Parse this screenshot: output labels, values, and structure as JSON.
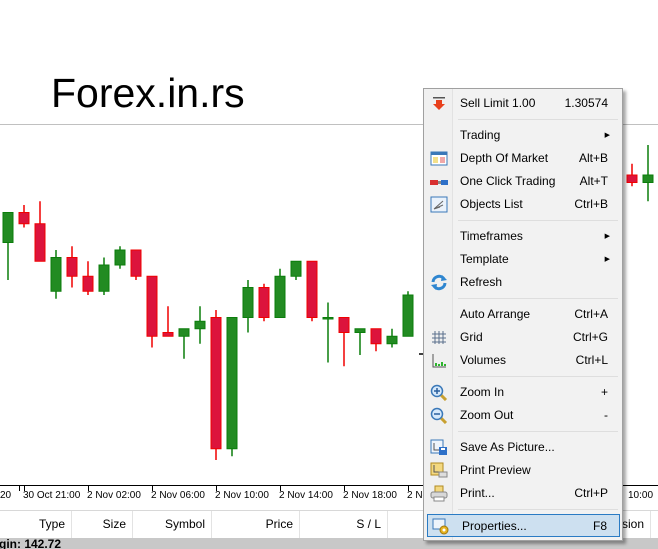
{
  "watermark": "Forex.in.rs",
  "colors": {
    "bull": "#228B22",
    "bull_border": "#0b7d0b",
    "bear": "#DC143C",
    "bear_border": "#f00000",
    "menu_highlight": "#cde0f0",
    "menu_highlight_border": "#2a7bc4"
  },
  "chart": {
    "ask_line_price": 1.30574,
    "candles": [
      {
        "o": 0.62,
        "h": 0.68,
        "l": 0.52,
        "c": 0.7
      },
      {
        "o": 0.7,
        "h": 0.72,
        "l": 0.66,
        "c": 0.67
      },
      {
        "o": 0.67,
        "h": 0.73,
        "l": 0.57,
        "c": 0.57
      },
      {
        "o": 0.49,
        "h": 0.6,
        "l": 0.47,
        "c": 0.58
      },
      {
        "o": 0.58,
        "h": 0.61,
        "l": 0.5,
        "c": 0.53
      },
      {
        "o": 0.53,
        "h": 0.57,
        "l": 0.48,
        "c": 0.49
      },
      {
        "o": 0.49,
        "h": 0.58,
        "l": 0.48,
        "c": 0.56
      },
      {
        "o": 0.56,
        "h": 0.61,
        "l": 0.55,
        "c": 0.6
      },
      {
        "o": 0.6,
        "h": 0.6,
        "l": 0.52,
        "c": 0.53
      },
      {
        "o": 0.53,
        "h": 0.53,
        "l": 0.34,
        "c": 0.37
      },
      {
        "o": 0.38,
        "h": 0.45,
        "l": 0.37,
        "c": 0.37
      },
      {
        "o": 0.37,
        "h": 0.39,
        "l": 0.31,
        "c": 0.39
      },
      {
        "o": 0.39,
        "h": 0.45,
        "l": 0.35,
        "c": 0.41
      },
      {
        "o": 0.42,
        "h": 0.44,
        "l": 0.04,
        "c": 0.07
      },
      {
        "o": 0.07,
        "h": 0.42,
        "l": 0.05,
        "c": 0.42
      },
      {
        "o": 0.42,
        "h": 0.52,
        "l": 0.38,
        "c": 0.5
      },
      {
        "o": 0.5,
        "h": 0.51,
        "l": 0.41,
        "c": 0.42
      },
      {
        "o": 0.42,
        "h": 0.55,
        "l": 0.42,
        "c": 0.53
      },
      {
        "o": 0.53,
        "h": 0.57,
        "l": 0.52,
        "c": 0.57
      },
      {
        "o": 0.57,
        "h": 0.57,
        "l": 0.41,
        "c": 0.42
      },
      {
        "o": 0.42,
        "h": 0.46,
        "l": 0.3,
        "c": 0.42
      },
      {
        "o": 0.42,
        "h": 0.42,
        "l": 0.29,
        "c": 0.38
      },
      {
        "o": 0.38,
        "h": 0.39,
        "l": 0.32,
        "c": 0.39
      },
      {
        "o": 0.39,
        "h": 0.39,
        "l": 0.33,
        "c": 0.35
      },
      {
        "o": 0.35,
        "h": 0.39,
        "l": 0.34,
        "c": 0.37
      },
      {
        "o": 0.37,
        "h": 0.49,
        "l": 0.37,
        "c": 0.48
      }
    ],
    "right_candles": [
      {
        "o": 0.8,
        "h": 0.83,
        "l": 0.77,
        "c": 0.78
      },
      {
        "o": 0.78,
        "h": 0.88,
        "l": 0.73,
        "c": 0.8
      }
    ],
    "time_labels": [
      "20",
      "30 Oct 21:00",
      "2 Nov 02:00",
      "2 Nov 06:00",
      "2 Nov 10:00",
      "2 Nov 14:00",
      "2 Nov 18:00",
      "2 No",
      "10:00"
    ]
  },
  "terminal": {
    "columns": [
      "Type",
      "Size",
      "Symbol",
      "Price",
      "S / L",
      "sion"
    ],
    "balance_text": "gin: 142.72"
  },
  "menu": {
    "items": [
      {
        "label": "Sell Limit 1.00",
        "shortcut": "1.30574",
        "icon": "sell-limit-arrow-icon"
      },
      {
        "label": "Trading",
        "submenu": true
      },
      {
        "label": "Depth Of Market",
        "shortcut": "Alt+B",
        "icon": "depth-of-market-icon"
      },
      {
        "label": "One Click Trading",
        "shortcut": "Alt+T",
        "icon": "one-click-trading-icon"
      },
      {
        "label": "Objects List",
        "shortcut": "Ctrl+B",
        "icon": "objects-list-icon"
      },
      {
        "label": "Timeframes",
        "submenu": true
      },
      {
        "label": "Template",
        "submenu": true
      },
      {
        "label": "Refresh",
        "icon": "refresh-icon"
      },
      {
        "label": "Auto Arrange",
        "shortcut": "Ctrl+A"
      },
      {
        "label": "Grid",
        "shortcut": "Ctrl+G",
        "icon": "grid-icon"
      },
      {
        "label": "Volumes",
        "shortcut": "Ctrl+L",
        "icon": "volumes-icon"
      },
      {
        "label": "Zoom In",
        "shortcut": "+",
        "icon": "zoom-in-icon"
      },
      {
        "label": "Zoom Out",
        "shortcut": "-",
        "icon": "zoom-out-icon"
      },
      {
        "label": "Save As Picture...",
        "icon": "save-picture-icon"
      },
      {
        "label": "Print Preview",
        "icon": "print-preview-icon"
      },
      {
        "label": "Print...",
        "shortcut": "Ctrl+P",
        "icon": "print-icon"
      },
      {
        "label": "Properties...",
        "shortcut": "F8",
        "icon": "properties-icon",
        "selected": true
      }
    ],
    "submenu_arrow": "▶"
  }
}
